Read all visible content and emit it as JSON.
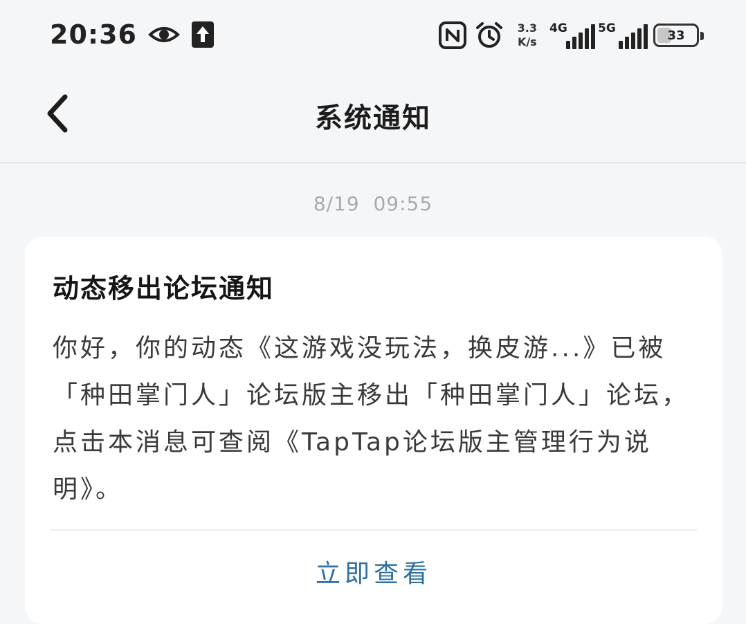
{
  "status_bar": {
    "time": "20:36",
    "net_speed_value": "3.3",
    "net_speed_unit": "K/s",
    "signal_1_label": "4G",
    "signal_2_label": "5G",
    "battery_level": "33",
    "icons": [
      "eye-icon",
      "upload-icon",
      "nfc-icon",
      "alarm-icon",
      "signal-4g-icon",
      "signal-5g-icon",
      "battery-icon"
    ]
  },
  "header": {
    "title": "系统通知",
    "back_icon": "chevron-left-icon"
  },
  "message": {
    "timestamp": "8/19  09:55",
    "title": "动态移出论坛通知",
    "body": "你好，你的动态《这游戏没玩法，换皮游...》已被「种田掌门人」论坛版主移出「种田掌门人」论坛，点击本消息可查阅《TapTap论坛版主管理行为说明》。",
    "action_label": "立即查看"
  },
  "colors": {
    "background": "#f5f6f8",
    "card": "#ffffff",
    "timestamp": "#a6abb3",
    "action": "#2f6fa3"
  }
}
